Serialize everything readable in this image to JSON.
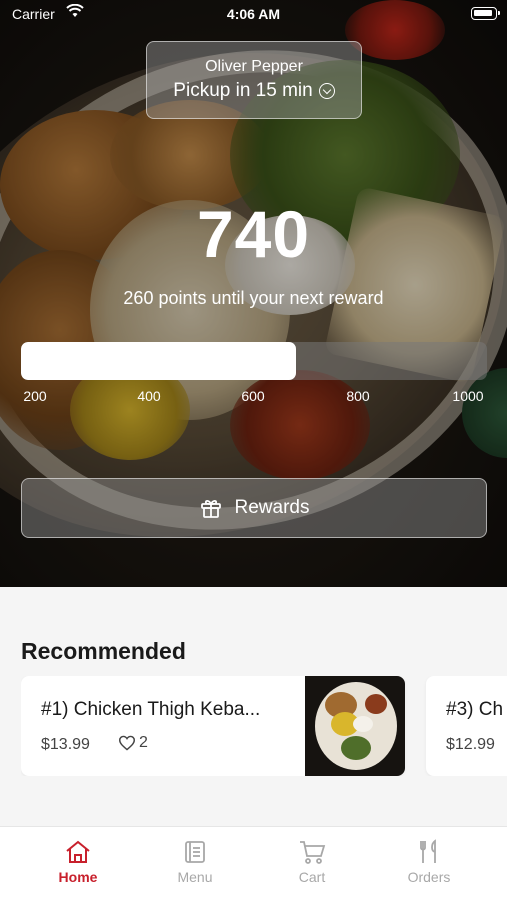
{
  "status_bar": {
    "carrier": "Carrier",
    "time": "4:06 AM"
  },
  "pickup": {
    "name": "Oliver Pepper",
    "time_label": "Pickup in 15 min"
  },
  "rewards": {
    "points": "740",
    "message": "260 points until your next reward",
    "progress_fraction": 0.59,
    "tick_labels": [
      "200",
      "400",
      "600",
      "800",
      "1000"
    ],
    "button_label": "Rewards"
  },
  "recommended": {
    "title": "Recommended",
    "items": [
      {
        "title": "#1) Chicken Thigh Keba...",
        "price": "$13.99",
        "likes": "2"
      },
      {
        "title": "#3) Ch",
        "price": "$12.99"
      }
    ]
  },
  "tab_bar": {
    "tabs": [
      {
        "label": "Home",
        "icon": "home-icon",
        "active": true
      },
      {
        "label": "Menu",
        "icon": "menu-book-icon",
        "active": false
      },
      {
        "label": "Cart",
        "icon": "cart-icon",
        "active": false
      },
      {
        "label": "Orders",
        "icon": "fork-knife-icon",
        "active": false
      }
    ]
  },
  "colors": {
    "accent": "#c8202c",
    "inactive_tab": "#a8a8a8"
  }
}
